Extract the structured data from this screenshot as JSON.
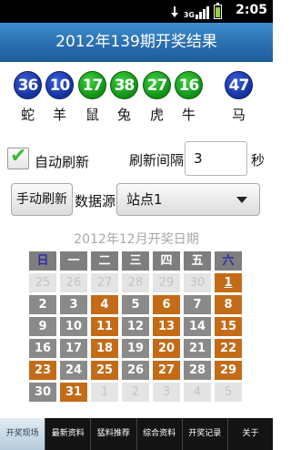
{
  "status_bar": {
    "network": "3G",
    "time": "2:05"
  },
  "title": "2012年139期开奖结果",
  "balls": [
    {
      "number": "36",
      "zodiac": "蛇",
      "color": "blue"
    },
    {
      "number": "10",
      "zodiac": "羊",
      "color": "blue"
    },
    {
      "number": "17",
      "zodiac": "鼠",
      "color": "green"
    },
    {
      "number": "38",
      "zodiac": "兔",
      "color": "green"
    },
    {
      "number": "27",
      "zodiac": "虎",
      "color": "green"
    },
    {
      "number": "16",
      "zodiac": "牛",
      "color": "green"
    },
    {
      "number": "47",
      "zodiac": "马",
      "color": "blue"
    }
  ],
  "controls": {
    "auto_refresh_label": "自动刷新",
    "auto_refresh_checked": true,
    "interval_label": "刷新间隔",
    "interval_value": "3",
    "interval_unit": "秒",
    "manual_refresh_label": "手动刷新",
    "data_source_label": "数据源",
    "data_source_value": "站点1"
  },
  "calendar": {
    "title": "2012年12月开奖日期",
    "weekdays": [
      "日",
      "一",
      "二",
      "三",
      "四",
      "五",
      "六"
    ],
    "weeks": [
      [
        {
          "d": "25",
          "t": "other"
        },
        {
          "d": "26",
          "t": "other"
        },
        {
          "d": "27",
          "t": "other"
        },
        {
          "d": "28",
          "t": "other"
        },
        {
          "d": "29",
          "t": "other"
        },
        {
          "d": "30",
          "t": "other"
        },
        {
          "d": "1",
          "t": "draw",
          "today": true
        }
      ],
      [
        {
          "d": "2",
          "t": "normal"
        },
        {
          "d": "3",
          "t": "normal"
        },
        {
          "d": "4",
          "t": "draw"
        },
        {
          "d": "5",
          "t": "normal"
        },
        {
          "d": "6",
          "t": "draw"
        },
        {
          "d": "7",
          "t": "normal"
        },
        {
          "d": "8",
          "t": "draw"
        }
      ],
      [
        {
          "d": "9",
          "t": "normal"
        },
        {
          "d": "10",
          "t": "normal"
        },
        {
          "d": "11",
          "t": "draw"
        },
        {
          "d": "12",
          "t": "normal"
        },
        {
          "d": "13",
          "t": "draw"
        },
        {
          "d": "14",
          "t": "normal"
        },
        {
          "d": "15",
          "t": "draw"
        }
      ],
      [
        {
          "d": "16",
          "t": "normal"
        },
        {
          "d": "17",
          "t": "normal"
        },
        {
          "d": "18",
          "t": "draw"
        },
        {
          "d": "19",
          "t": "normal"
        },
        {
          "d": "20",
          "t": "draw"
        },
        {
          "d": "21",
          "t": "normal"
        },
        {
          "d": "22",
          "t": "draw"
        }
      ],
      [
        {
          "d": "23",
          "t": "draw"
        },
        {
          "d": "24",
          "t": "normal"
        },
        {
          "d": "25",
          "t": "draw"
        },
        {
          "d": "26",
          "t": "normal"
        },
        {
          "d": "27",
          "t": "draw"
        },
        {
          "d": "28",
          "t": "normal"
        },
        {
          "d": "29",
          "t": "draw"
        }
      ],
      [
        {
          "d": "30",
          "t": "normal"
        },
        {
          "d": "31",
          "t": "draw"
        },
        {
          "d": "1",
          "t": "other"
        },
        {
          "d": "2",
          "t": "other"
        },
        {
          "d": "3",
          "t": "other"
        },
        {
          "d": "4",
          "t": "other"
        },
        {
          "d": "5",
          "t": "other"
        }
      ]
    ]
  },
  "tabs": [
    {
      "label": "开奖现场",
      "active": true
    },
    {
      "label": "最新资料",
      "active": false
    },
    {
      "label": "猛料推荐",
      "active": false
    },
    {
      "label": "综合资料",
      "active": false
    },
    {
      "label": "开奖记录",
      "active": false
    },
    {
      "label": "关于",
      "active": false
    }
  ],
  "colors": {
    "title_bar": "#2a6fb0",
    "ball_blue": "#14309c",
    "ball_green": "#0f8f15",
    "draw_day": "#c46b18",
    "normal_day": "#8a8a8a",
    "other_month_day": "#e4e4e4"
  }
}
